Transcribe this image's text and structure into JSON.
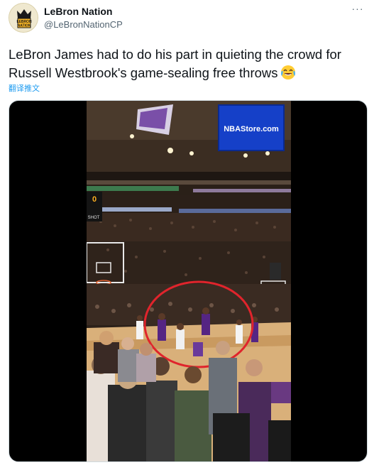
{
  "account": {
    "display_name": "LeBron Nation",
    "handle": "@LeBronNationCP",
    "avatar_text_top": "LEBRON",
    "avatar_text_bottom": "NATION"
  },
  "menu": {
    "more_label": "···"
  },
  "tweet": {
    "text": "LeBron James had to do his part in quieting the crowd for Russell Westbrook's game-sealing free throws",
    "emoji": "face-with-tears-of-joy",
    "translate_label": "翻译推文"
  },
  "media": {
    "jumbotron_text": "NBAStore.com",
    "shot_clock_text": "0",
    "shot_label": "SHOT",
    "annotation_color": "#e0242c"
  },
  "colors": {
    "accent": "#1d9bf0",
    "text": "#0f1419",
    "secondary": "#536471",
    "lakers_purple": "#552583",
    "lakers_gold": "#fdb927"
  }
}
